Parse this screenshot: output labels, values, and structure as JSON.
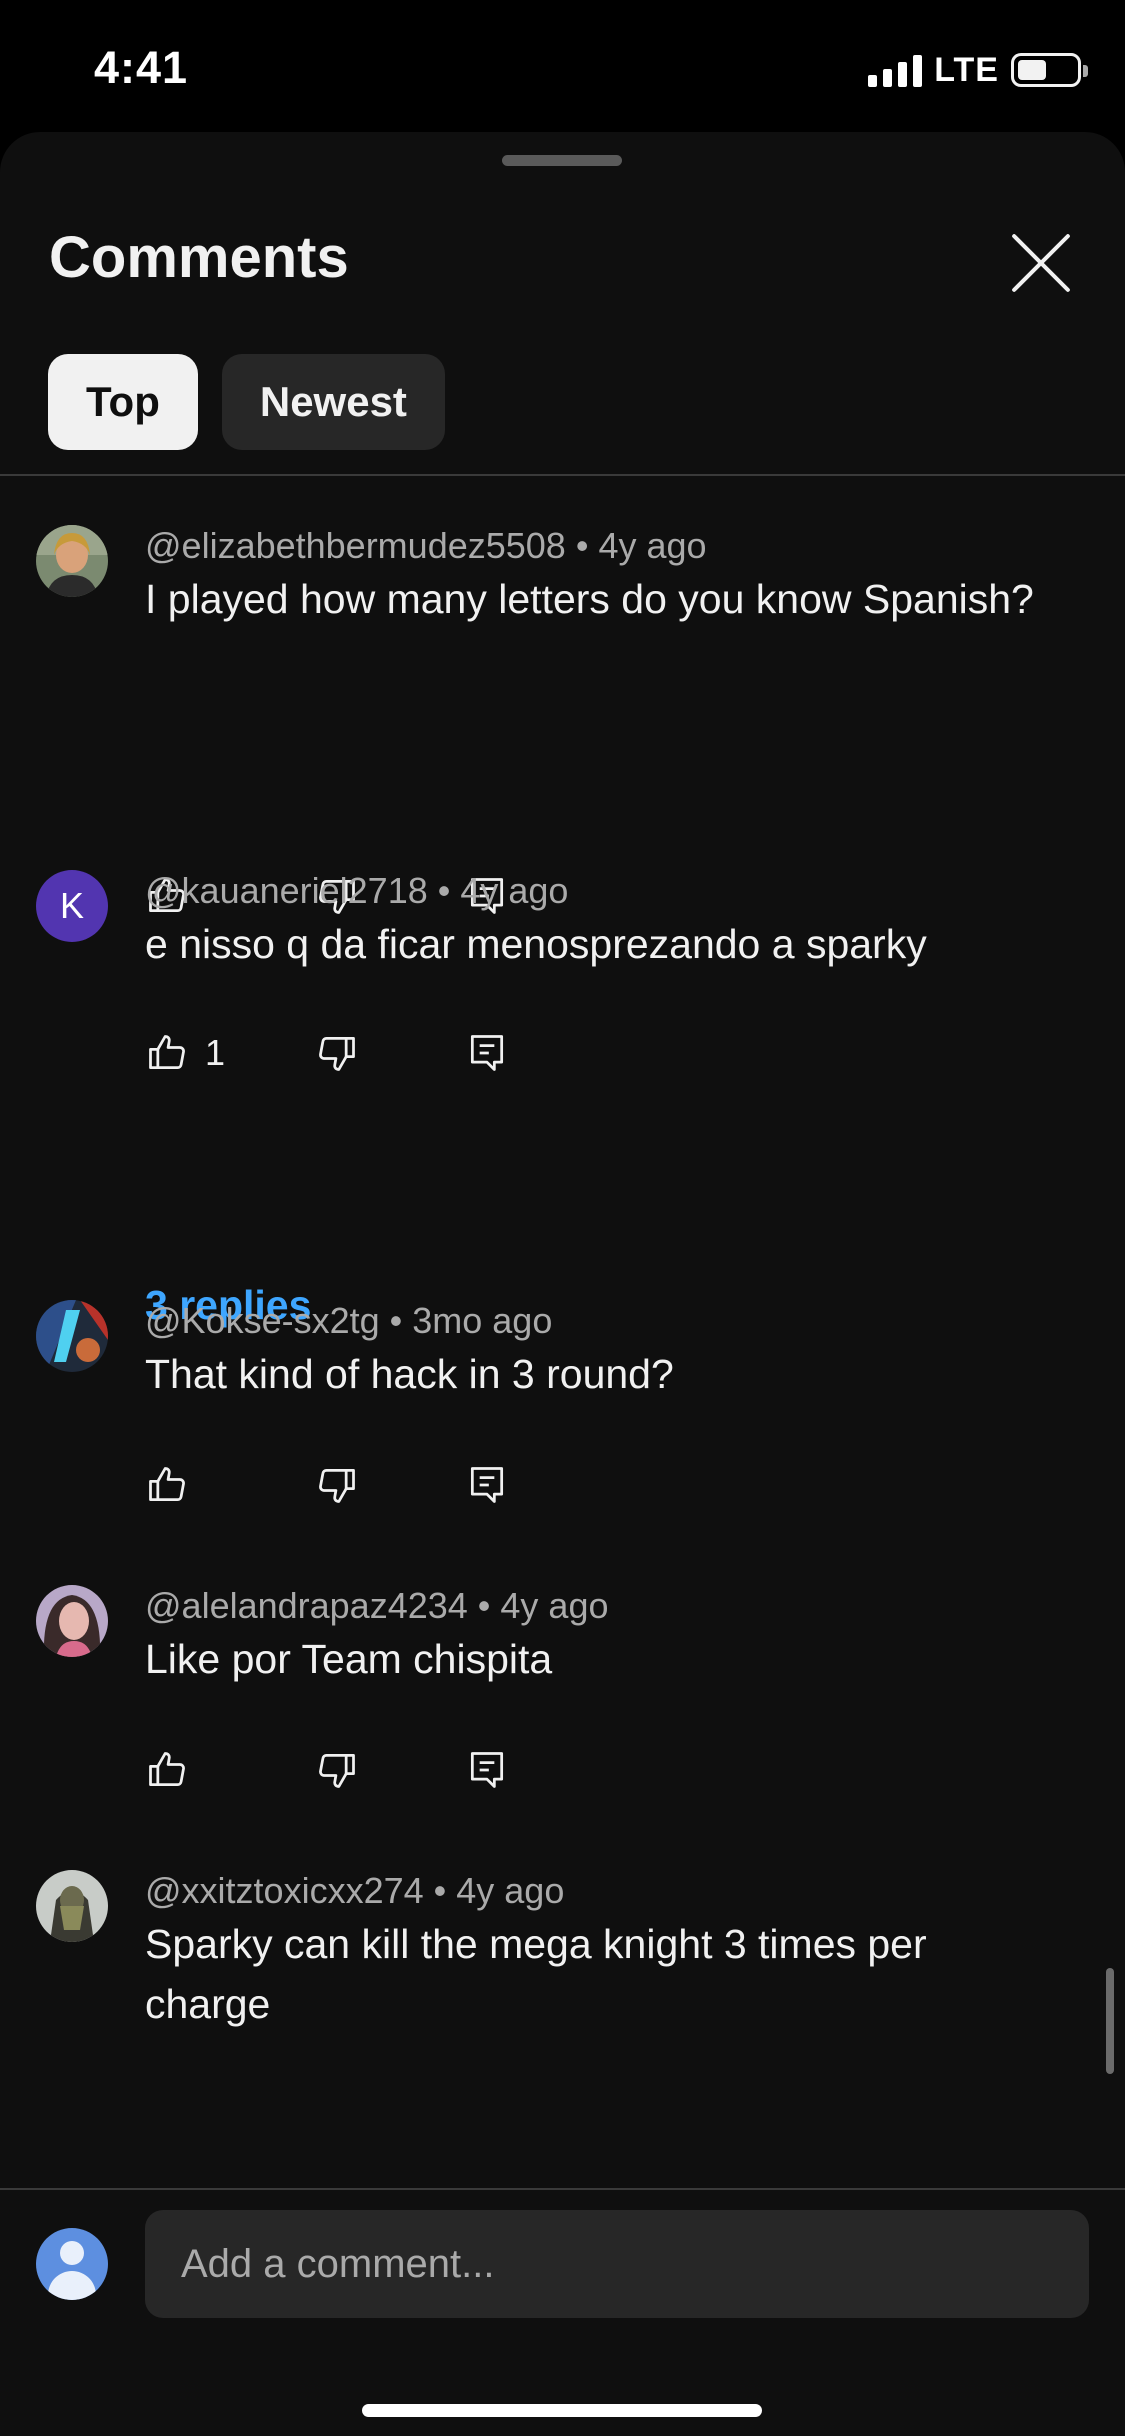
{
  "status_bar": {
    "time": "4:41",
    "network": "LTE"
  },
  "sheet": {
    "title": "Comments",
    "tabs": [
      {
        "label": "Top",
        "active": true
      },
      {
        "label": "Newest",
        "active": false
      }
    ]
  },
  "comments": [
    {
      "author": "@elizabethbermudez5508",
      "separator": "•",
      "age": "4y ago",
      "text": "I played how many letters do you know Spanish?",
      "likes": ""
    },
    {
      "author": "@kauaneriel2718",
      "separator": "•",
      "age": "4y ago",
      "avatar_letter": "K",
      "text": "e nisso q da ficar menosprezando a sparky",
      "likes": "1",
      "replies": "3 replies"
    },
    {
      "author": "@Kokse-sx2tg",
      "separator": "•",
      "age": "3mo ago",
      "text": "That kind of hack in 3 round?",
      "likes": ""
    },
    {
      "author": "@alelandrapaz4234",
      "separator": "•",
      "age": "4y ago",
      "text": "Like por Team chispita",
      "likes": ""
    },
    {
      "author": "@xxitztoxicxx274",
      "separator": "•",
      "age": "4y ago",
      "text": "Sparky can kill the mega knight 3 times per charge",
      "likes": ""
    }
  ],
  "composer": {
    "placeholder": "Add a comment..."
  },
  "colors": {
    "background": "#0f0f0f",
    "link": "#3ea6ff",
    "chip_active": "#f1f1f1",
    "chip_inactive": "#272727"
  },
  "icons": [
    "like-icon",
    "dislike-icon",
    "reply-icon",
    "close-icon",
    "signal-icon",
    "battery-icon"
  ]
}
